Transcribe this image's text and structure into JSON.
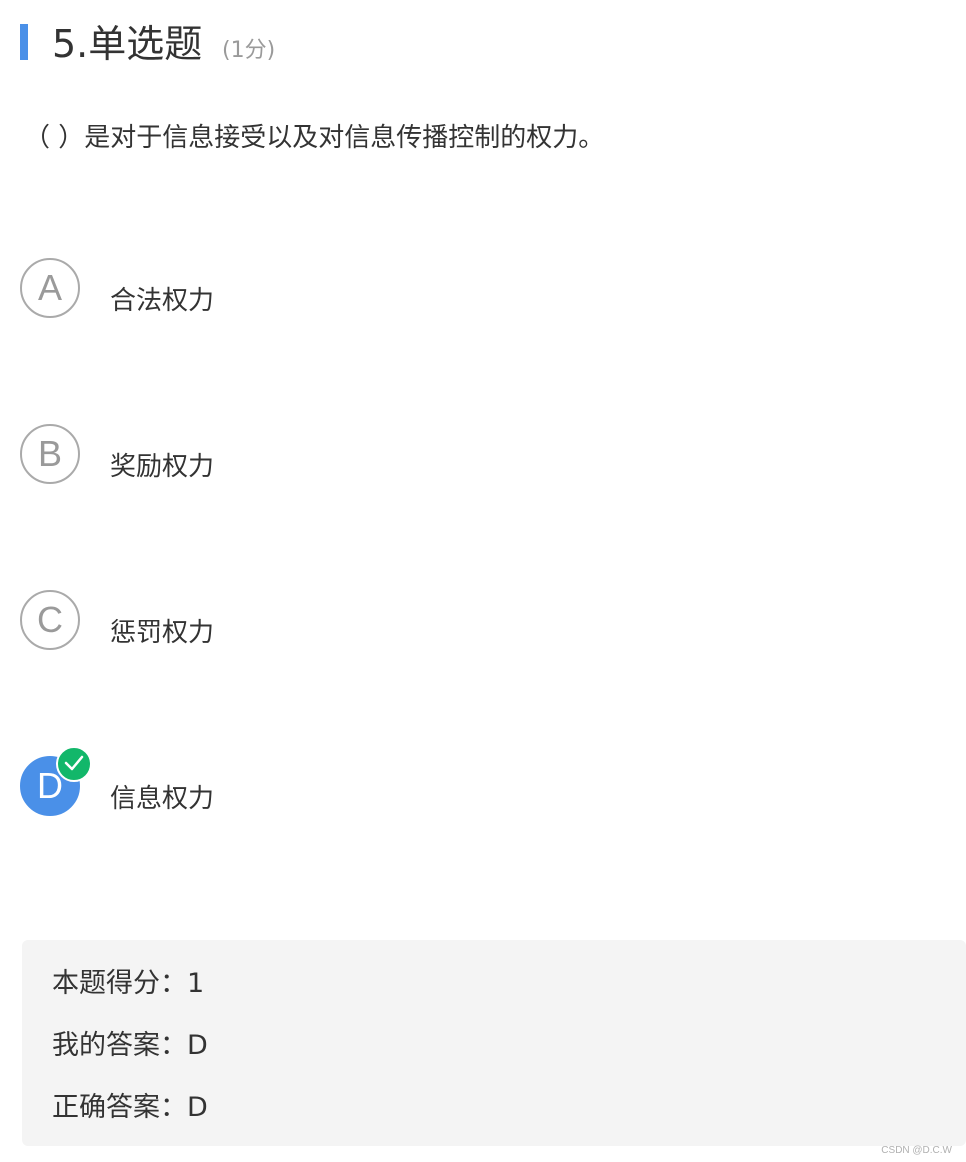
{
  "question": {
    "number_title": "5.单选题",
    "score_hint": "(1分)",
    "stem": "（ ）是对于信息接受以及对信息传播控制的权力。",
    "options": [
      {
        "letter": "A",
        "text": "合法权力",
        "selected": false
      },
      {
        "letter": "B",
        "text": "奖励权力",
        "selected": false
      },
      {
        "letter": "C",
        "text": "惩罚权力",
        "selected": false
      },
      {
        "letter": "D",
        "text": "信息权力",
        "selected": true
      }
    ]
  },
  "result": {
    "score_line": "本题得分：1",
    "my_answer_line": "我的答案：D",
    "correct_answer_line": "正确答案：D"
  },
  "watermark": "CSDN @D.C.W",
  "colors": {
    "accent": "#4a90e8",
    "check": "#12b76a",
    "panel_bg": "#f4f4f4"
  }
}
